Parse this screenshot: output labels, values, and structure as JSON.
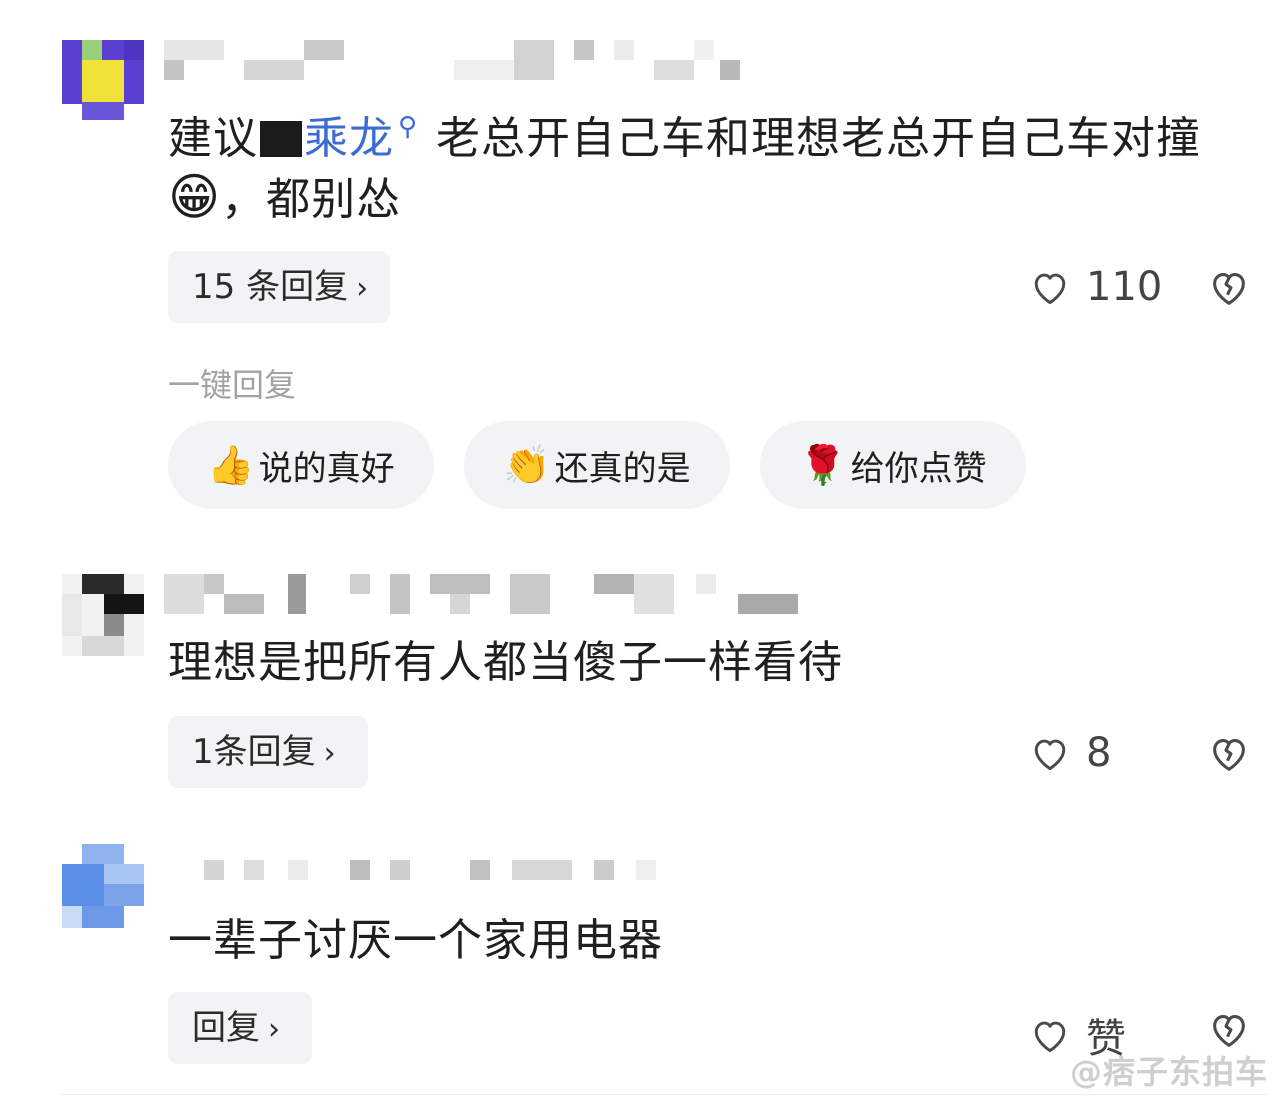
{
  "comments": [
    {
      "text_prefix": "建议",
      "text_link": "乘龙",
      "text_main": "老总开自己车和理想老总开自己车对撞",
      "emoji": "😁",
      "text_suffix": "，都别怂",
      "reply_label": "15 条回复",
      "like_count": "110"
    },
    {
      "text": "理想是把所有人都当傻子一样看待",
      "reply_label": "1条回复",
      "like_count": "8"
    },
    {
      "text": "一辈子讨厌一个家用电器",
      "reply_label": "回复",
      "like_count": "赞"
    }
  ],
  "quick_reply": {
    "label": "一键回复",
    "chips": [
      {
        "emoji": "👍",
        "text": "说的真好"
      },
      {
        "emoji": "👏",
        "text": "还真的是"
      },
      {
        "emoji": "🌹",
        "text": "给你点赞"
      }
    ]
  },
  "icons": {
    "like": "heart-icon",
    "dislike": "broken-heart-icon",
    "chevron": "chevron-right-icon",
    "search": "search-icon"
  },
  "watermark": "@痞子东拍车"
}
